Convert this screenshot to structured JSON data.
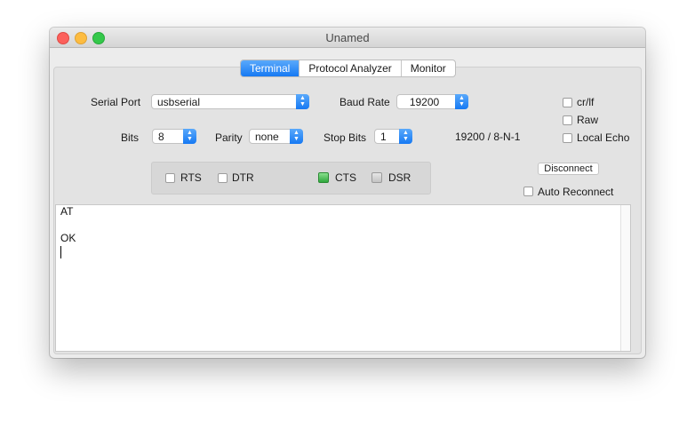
{
  "window": {
    "title": "Unamed"
  },
  "tabs": [
    {
      "label": "Terminal",
      "active": true
    },
    {
      "label": "Protocol Analyzer",
      "active": false
    },
    {
      "label": "Monitor",
      "active": false
    }
  ],
  "settings": {
    "serial_port": {
      "label": "Serial Port",
      "value": "usbserial"
    },
    "baud_rate": {
      "label": "Baud Rate",
      "value": "19200"
    },
    "bits": {
      "label": "Bits",
      "value": "8"
    },
    "parity": {
      "label": "Parity",
      "value": "none"
    },
    "stop_bits": {
      "label": "Stop Bits",
      "value": "1"
    },
    "summary": "19200 / 8-N-1"
  },
  "options": {
    "crlf": {
      "label": "cr/lf",
      "checked": false
    },
    "raw": {
      "label": "Raw",
      "checked": false
    },
    "local_echo": {
      "label": "Local Echo",
      "checked": false
    }
  },
  "signals": {
    "rts": {
      "label": "RTS",
      "checked": false
    },
    "dtr": {
      "label": "DTR",
      "checked": false
    },
    "cts": {
      "label": "CTS",
      "state": "on"
    },
    "dsr": {
      "label": "DSR",
      "state": "off"
    }
  },
  "connection": {
    "disconnect_label": "Disconnect",
    "auto_reconnect": {
      "label": "Auto Reconnect",
      "checked": false
    }
  },
  "terminal": {
    "lines": [
      "AT",
      "",
      "OK"
    ]
  },
  "colors": {
    "accent": "#1679f3",
    "led_on": "#2fa83d",
    "led_off": "#c3c3c3"
  }
}
